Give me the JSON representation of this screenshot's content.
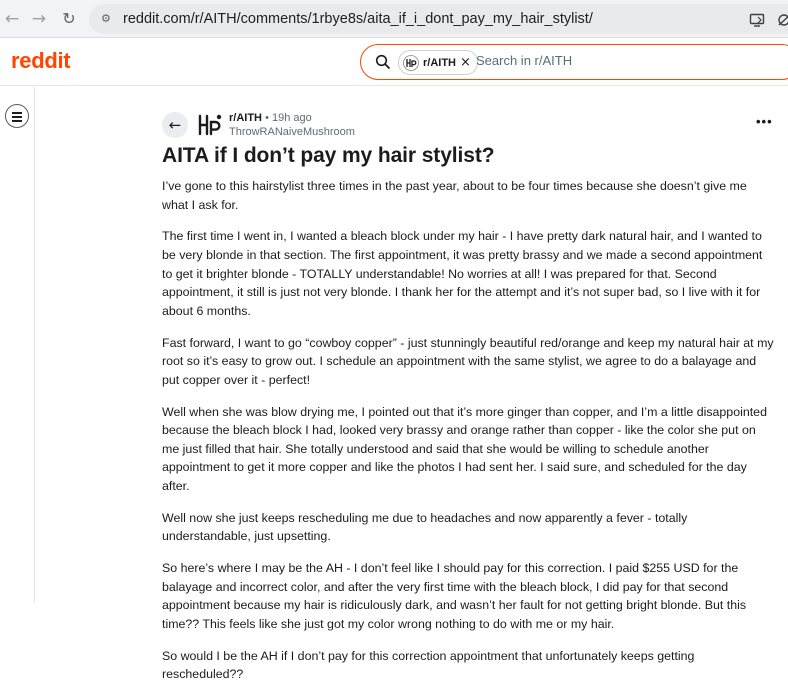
{
  "browser": {
    "url": "reddit.com/r/AITH/comments/1rbye8s/aita_if_i_dont_pay_my_hair_stylist/",
    "icons": [
      "back-arrow-icon",
      "forward-arrow-icon",
      "reload-icon",
      "site-info-icon",
      "cast-icon",
      "extension-icon"
    ]
  },
  "header": {
    "logo": "reddit",
    "search": {
      "chip_label": "r/AITH",
      "chip_close": "×",
      "placeholder": "Search in r/AITH"
    }
  },
  "post": {
    "subreddit": "r/AITH",
    "separator": "•",
    "time": "19h ago",
    "author": "ThrowRANaiveMushroom",
    "more": "•••",
    "title": "AITA if I don’t pay my hair stylist?",
    "paragraphs": [
      "I’ve gone to this hairstylist three times in the past year, about to be four times because she doesn’t give me what I ask for.",
      "The first time I went in, I wanted a bleach block under my hair - I have pretty dark natural hair, and I wanted to be very blonde in that section. The first appointment, it was pretty brassy and we made a second appointment to get it brighter blonde - TOTALLY understandable! No worries at all! I was prepared for that. Second appointment, it still is just not very blonde. I thank her for the attempt and it’s not super bad, so I live with it for about 6 months.",
      "Fast forward, I want to go “cowboy copper” - just stunningly beautiful red/orange and keep my natural hair at my root so it’s easy to grow out. I schedule an appointment with the same stylist, we agree to do a balayage and put copper over it - perfect!",
      "Well when she was blow drying me, I pointed out that it’s more ginger than copper, and I’m a little disappointed because the bleach block I had, looked very brassy and orange rather than copper - like the color she put on me just filled that hair. She totally understood and said that she would be willing to schedule another appointment to get it more copper and like the photos I had sent her. I said sure, and scheduled for the day after.",
      "Well now she just keeps rescheduling me due to headaches and now apparently a fever - totally understandable, just upsetting.",
      "So here’s where I may be the AH - I don’t feel like I should pay for this correction. I paid $255 USD for the balayage and incorrect color, and after the very first time with the bleach block, I did pay for that second appointment because my hair is ridiculously dark, and wasn’t her fault for not getting bright blonde. But this time?? This feels like she just got my color wrong nothing to do with me or my hair.",
      "So would I be the AH if I don’t pay for this correction appointment that unfortunately keeps getting rescheduled??"
    ]
  },
  "colors": {
    "brand": "#ff4500",
    "text": "#1c1c1c",
    "muted": "#576f76"
  }
}
